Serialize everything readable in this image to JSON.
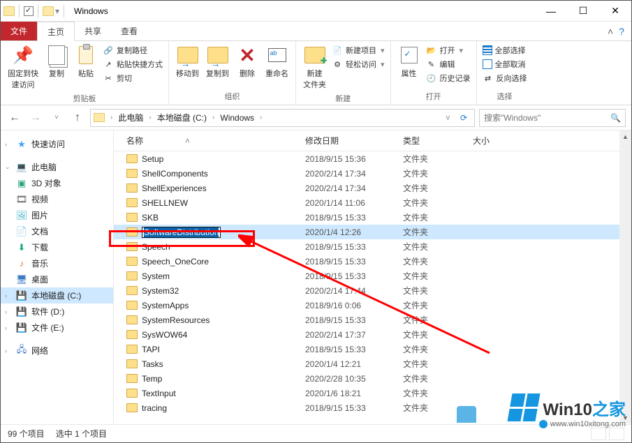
{
  "window": {
    "title": "Windows"
  },
  "tabs": {
    "file": "文件",
    "home": "主页",
    "share": "共享",
    "view": "查看"
  },
  "ribbon": {
    "clipboard": {
      "pin": "固定到快\n速访问",
      "copy": "复制",
      "paste": "粘贴",
      "copy_path": "复制路径",
      "paste_shortcut": "粘贴快捷方式",
      "cut": "剪切",
      "label": "剪贴板"
    },
    "organize": {
      "move_to": "移动到",
      "copy_to": "复制到",
      "delete": "删除",
      "rename": "重命名",
      "label": "组织"
    },
    "new": {
      "new_folder": "新建\n文件夹",
      "new_item": "新建项目",
      "easy_access": "轻松访问",
      "label": "新建"
    },
    "open": {
      "properties": "属性",
      "open": "打开",
      "edit": "编辑",
      "history": "历史记录",
      "label": "打开"
    },
    "select": {
      "select_all": "全部选择",
      "select_none": "全部取消",
      "invert": "反向选择",
      "label": "选择"
    }
  },
  "breadcrumbs": [
    "此电脑",
    "本地磁盘 (C:)",
    "Windows"
  ],
  "search": {
    "placeholder": "搜索\"Windows\""
  },
  "columns": {
    "name": "名称",
    "date": "修改日期",
    "type": "类型",
    "size": "大小"
  },
  "sidebar": {
    "quick": "快速访问",
    "pc": "此电脑",
    "objects3d": "3D 对象",
    "videos": "视频",
    "pictures": "图片",
    "documents": "文档",
    "downloads": "下载",
    "music": "音乐",
    "desktop": "桌面",
    "disk_c": "本地磁盘 (C:)",
    "disk_d": "软件 (D:)",
    "disk_e": "文件 (E:)",
    "network": "网络"
  },
  "type_folder": "文件夹",
  "files": [
    {
      "name": "Setup",
      "date": "2018/9/15 15:36"
    },
    {
      "name": "ShellComponents",
      "date": "2020/2/14 17:34"
    },
    {
      "name": "ShellExperiences",
      "date": "2020/2/14 17:34"
    },
    {
      "name": "SHELLNEW",
      "date": "2020/1/14 11:06"
    },
    {
      "name": "SKB",
      "date": "2018/9/15 15:33"
    },
    {
      "name": "SoftwareDistribution",
      "date": "2020/1/4 12:26",
      "selected": true
    },
    {
      "name": "Speech",
      "date": "2018/9/15 15:33"
    },
    {
      "name": "Speech_OneCore",
      "date": "2018/9/15 15:33"
    },
    {
      "name": "System",
      "date": "2018/9/15 15:33"
    },
    {
      "name": "System32",
      "date": "2020/2/14 17:44"
    },
    {
      "name": "SystemApps",
      "date": "2018/9/16 0:06"
    },
    {
      "name": "SystemResources",
      "date": "2018/9/15 15:33"
    },
    {
      "name": "SysWOW64",
      "date": "2020/2/14 17:37"
    },
    {
      "name": "TAPI",
      "date": "2018/9/15 15:33"
    },
    {
      "name": "Tasks",
      "date": "2020/1/4 12:21"
    },
    {
      "name": "Temp",
      "date": "2020/2/28 10:35"
    },
    {
      "name": "TextInput",
      "date": "2020/1/6 18:21"
    },
    {
      "name": "tracing",
      "date": "2018/9/15 15:33"
    }
  ],
  "status": {
    "count": "99 个项目",
    "selected": "选中 1 个项目"
  },
  "watermark": {
    "brand_en": "Win10",
    "brand_zh": "之家",
    "url": "www.win10xitong.com"
  }
}
